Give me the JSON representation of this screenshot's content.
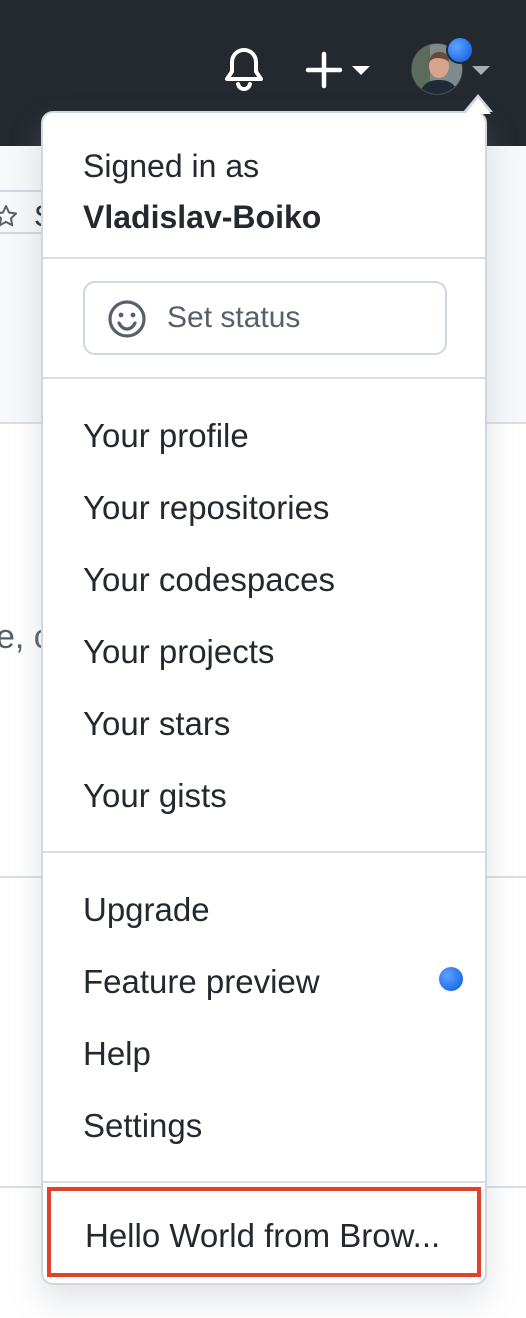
{
  "header": {
    "icons": [
      "bell-icon",
      "plus-icon",
      "caret-down-icon"
    ],
    "avatar_badge_color": "#2f81f7"
  },
  "background": {
    "star_label": "S",
    "fragment_text": "e, c"
  },
  "menu": {
    "signed_in_prefix": "Signed in as",
    "username": "Vladislav-Boiko",
    "set_status": "Set status",
    "profile_items": [
      "Your profile",
      "Your repositories",
      "Your codespaces",
      "Your projects",
      "Your stars",
      "Your gists"
    ],
    "general_items": [
      "Upgrade",
      "Feature preview",
      "Help",
      "Settings"
    ],
    "custom_item": "Hello World from Brow...",
    "highlight_color": "#e0412b",
    "feature_preview_dot_color": "#2f81f7"
  }
}
